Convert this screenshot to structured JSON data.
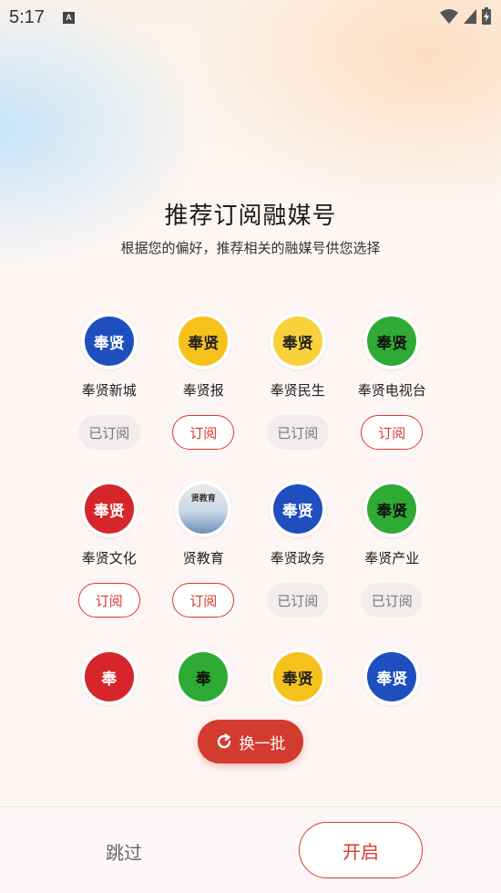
{
  "status_bar": {
    "time": "5:17",
    "notification_letter": "A"
  },
  "header": {
    "title": "推荐订阅融媒号",
    "subtitle": "根据您的偏好，推荐相关的融媒号供您选择"
  },
  "rows": [
    [
      {
        "name": "奉贤新城",
        "logo_text": "奉贤",
        "logo_style": "blue",
        "button": "已订阅",
        "subscribed": true
      },
      {
        "name": "奉贤报",
        "logo_text": "奉贤",
        "logo_style": "yellow",
        "button": "订阅",
        "subscribed": false
      },
      {
        "name": "奉贤民生",
        "logo_text": "奉贤",
        "logo_style": "yellow",
        "button": "已订阅",
        "subscribed": true
      },
      {
        "name": "奉贤电视台",
        "logo_text": "奉贤",
        "logo_style": "green",
        "button": "订阅",
        "subscribed": false
      }
    ],
    [
      {
        "name": "奉贤文化",
        "logo_text": "奉贤",
        "logo_style": "red",
        "button": "订阅",
        "subscribed": false
      },
      {
        "name": "贤教育",
        "logo_text": "贤教育",
        "logo_style": "photo",
        "button": "订阅",
        "subscribed": false
      },
      {
        "name": "奉贤政务",
        "logo_text": "奉贤",
        "logo_style": "blue",
        "button": "已订阅",
        "subscribed": true
      },
      {
        "name": "奉贤产业",
        "logo_text": "奉贤",
        "logo_style": "green",
        "button": "已订阅",
        "subscribed": true
      }
    ],
    [
      {
        "name": "",
        "logo_text": "奉",
        "logo_style": "red"
      },
      {
        "name": "",
        "logo_text": "奉",
        "logo_style": "green"
      },
      {
        "name": "",
        "logo_text": "奉贤",
        "logo_style": "yellow"
      },
      {
        "name": "",
        "logo_text": "奉贤",
        "logo_style": "blue"
      }
    ]
  ],
  "refresh_button": {
    "label": "换一批",
    "icon": "refresh-icon"
  },
  "footer": {
    "skip_label": "跳过",
    "start_label": "开启"
  },
  "colors": {
    "accent": "#d9392f",
    "accent_fill": "#d43b2f",
    "subscribed_bg": "#f0edec"
  }
}
